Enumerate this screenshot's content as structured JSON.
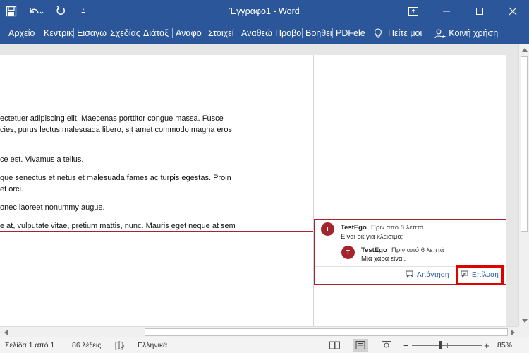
{
  "window": {
    "title": "Έγγραφο1 - Word",
    "controls": [
      "ribbon-display-options-icon",
      "minimize-icon",
      "maximize-icon",
      "close-icon"
    ]
  },
  "qat": {
    "save_icon": "save-icon",
    "undo_icon": "undo-icon",
    "redo_icon": "redo-icon",
    "customize_glyph": "⩮"
  },
  "ribbon": {
    "tabs": [
      "Αρχείο",
      "Κεντρικ",
      "Εισαγω",
      "Σχεδίας",
      "Διάταξ",
      "Αναφο",
      "Στοιχεί",
      "Αναθεώ",
      "Προβο",
      "Βοηθει",
      "PDFelei"
    ],
    "tell_me": "Πείτε μοι",
    "share": "Κοινή χρήση"
  },
  "document": {
    "lines": [
      "ectetuer adipiscing elit. Maecenas porttitor congue massa. Fusce",
      "cies, purus lectus malesuada libero, sit amet commodo magna eros",
      "ce est. Vivamus a tellus.",
      "que senectus et netus et malesuada fames ac turpis egestas. Proin",
      "et orci.",
      "onec laoreet nonummy augue.",
      "e at, vulputate vitae, pretium mattis, nunc. Mauris eget neque at sem"
    ]
  },
  "comment": {
    "thread": [
      {
        "initial": "T",
        "author": "TestEgo",
        "time": "Πριν από 8 λεπτά",
        "text": "Είναι οκ για κλείσιμο;"
      },
      {
        "initial": "T",
        "author": "TestEgo",
        "time": "Πριν από 6 λεπτά",
        "text": "Μία χαρά είναι."
      }
    ],
    "reply_label": "Απάντηση",
    "resolve_label": "Επίλυση"
  },
  "status": {
    "page": "Σελίδα 1 από 1",
    "words": "86 λέξεις",
    "language": "Ελληνικά",
    "zoom": "85%",
    "zoom_minus": "−",
    "zoom_plus": "+",
    "zoom_value": 0.85
  },
  "colors": {
    "word_blue": "#2b579a",
    "comment_red": "#a4262c",
    "highlight_red": "#e00000"
  }
}
